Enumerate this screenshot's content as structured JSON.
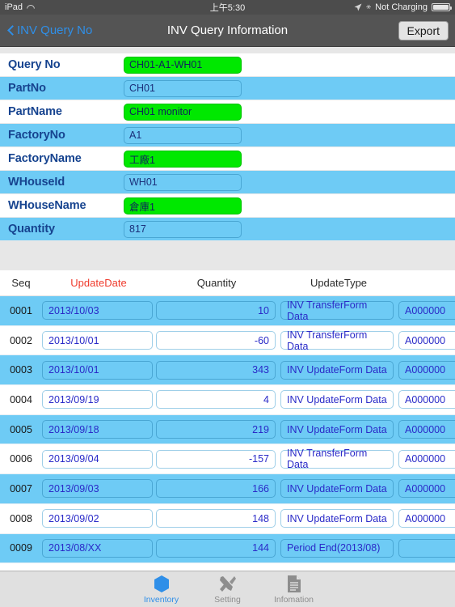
{
  "statusbar": {
    "device": "iPad",
    "wifi_icon": "wifi-icon",
    "time": "上午5:30",
    "location_icon": "location-arrow-icon",
    "bluetooth_icon": "bluetooth-icon",
    "charging_status": "Not Charging",
    "battery_icon": "battery-icon"
  },
  "navbar": {
    "back_icon": "chevron-left-icon",
    "back_label": "INV Query No",
    "title": "INV Query Information",
    "export_label": "Export"
  },
  "form": {
    "rows": [
      {
        "label": "Query No",
        "value": "CH01-A1-WH01",
        "highlight": "green"
      },
      {
        "label": "PartNo",
        "value": "CH01",
        "highlight": "none"
      },
      {
        "label": "PartName",
        "value": "CH01 monitor",
        "highlight": "green"
      },
      {
        "label": "FactoryNo",
        "value": "A1",
        "highlight": "none"
      },
      {
        "label": "FactoryName",
        "value": "工廠1",
        "highlight": "green"
      },
      {
        "label": "WHouseId",
        "value": "WH01",
        "highlight": "none"
      },
      {
        "label": "WHouseName",
        "value": "倉庫1",
        "highlight": "green"
      },
      {
        "label": "Quantity",
        "value": "817",
        "highlight": "none"
      }
    ]
  },
  "table": {
    "headers": {
      "seq": "Seq",
      "update_date": "UpdateDate",
      "quantity": "Quantity",
      "update_type": "UpdateType",
      "extra": ""
    },
    "rows": [
      {
        "seq": "0001",
        "date": "2013/10/03",
        "qty": "10",
        "type": "INV TransferForm Data",
        "extra": "A000000"
      },
      {
        "seq": "0002",
        "date": "2013/10/01",
        "qty": "-60",
        "type": "INV TransferForm Data",
        "extra": "A000000"
      },
      {
        "seq": "0003",
        "date": "2013/10/01",
        "qty": "343",
        "type": "INV UpdateForm Data",
        "extra": "A000000"
      },
      {
        "seq": "0004",
        "date": "2013/09/19",
        "qty": "4",
        "type": "INV UpdateForm Data",
        "extra": "A000000"
      },
      {
        "seq": "0005",
        "date": "2013/09/18",
        "qty": "219",
        "type": "INV UpdateForm Data",
        "extra": "A000000"
      },
      {
        "seq": "0006",
        "date": "2013/09/04",
        "qty": "-157",
        "type": "INV TransferForm Data",
        "extra": "A000000"
      },
      {
        "seq": "0007",
        "date": "2013/09/03",
        "qty": "166",
        "type": "INV UpdateForm Data",
        "extra": "A000000"
      },
      {
        "seq": "0008",
        "date": "2013/09/02",
        "qty": "148",
        "type": "INV UpdateForm Data",
        "extra": "A000000"
      },
      {
        "seq": "0009",
        "date": "2013/08/XX",
        "qty": "144",
        "type": "Period End(2013/08)",
        "extra": ""
      }
    ]
  },
  "tabbar": {
    "tabs": [
      {
        "label": "Inventory",
        "icon": "hexagon-icon",
        "active": true
      },
      {
        "label": "Setting",
        "icon": "tools-icon",
        "active": false
      },
      {
        "label": "Infomation",
        "icon": "document-icon",
        "active": false
      }
    ]
  },
  "colors": {
    "accent_blue": "#2f8fe8",
    "row_blue": "#6ecbf5",
    "highlight_green": "#00e800",
    "header_red": "#ef3b2d",
    "label_navy": "#16438f"
  }
}
